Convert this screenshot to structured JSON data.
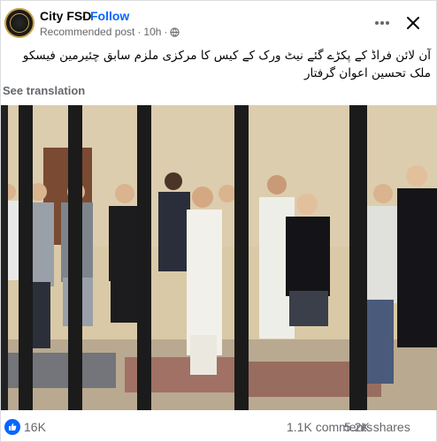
{
  "post": {
    "page_name": "City FSD",
    "separator": "·",
    "follow_label": "Follow",
    "meta_label": "Recommended post",
    "time": "10h",
    "time_separator": "·",
    "caption": "آن لائن فراڈ کے پکڑے گئے نیٹ ورک کے کیس کا مرکزی ملزم سابق چئیرمین فیسکو  ملک تحسین اعوان گرفتار",
    "see_translation": "See translation"
  },
  "icons": {
    "globe": "globe-icon",
    "more": "more-horizontal-icon",
    "close": "close-icon",
    "like": "thumbs-up-icon"
  },
  "reactions": {
    "like_count": "16K",
    "comments": "1.1K comments",
    "shares": "5.2K shares"
  },
  "colors": {
    "accent": "#0866ff",
    "secondary_text": "#65676b",
    "primary_text": "#050505"
  }
}
